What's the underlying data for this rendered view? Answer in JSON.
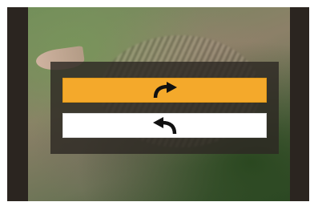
{
  "background": {
    "subject": "cat-photo"
  },
  "menu": {
    "options": [
      {
        "icon": "rotate-clockwise-arrow-icon",
        "selected": true,
        "color": "#f4a92b"
      },
      {
        "icon": "rotate-counterclockwise-arrow-icon",
        "selected": false,
        "color": "#ffffff"
      }
    ],
    "panel_color": "#2d2823",
    "icon_color": "#111111"
  }
}
